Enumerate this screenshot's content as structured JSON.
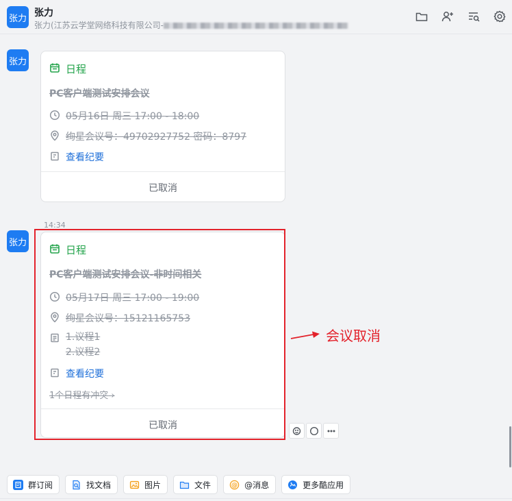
{
  "header": {
    "avatar_text": "张力",
    "name": "张力",
    "subtitle_prefix": "张力(江苏云学堂网络科技有限公司-"
  },
  "messages": [
    {
      "avatar_text": "张力",
      "card_title": "日程",
      "subject": "PC客户端测试安排会议",
      "time": "05月16日 周三 17:00 - 18:00",
      "meeting": "绚星会议号：49702927752 密码：8797",
      "notes_link": "查看纪要",
      "status": "已取消"
    },
    {
      "timestamp": "14:34",
      "avatar_text": "张力",
      "card_title": "日程",
      "subject": "PC客户端测试安排会议-非时间相关",
      "time": "05月17日 周三 17:00 - 19:00",
      "meeting": "绚星会议号：15121165753",
      "agenda": [
        "1.议程1",
        "2.议程2"
      ],
      "notes_link": "查看纪要",
      "conflict": "1个日程有冲突",
      "status": "已取消"
    }
  ],
  "annotation": {
    "text": "会议取消",
    "color": "#e3212a"
  },
  "toolbar": [
    {
      "label": "群订阅",
      "icon": "subscribe-icon"
    },
    {
      "label": "找文档",
      "icon": "find-doc-icon"
    },
    {
      "label": "图片",
      "icon": "image-icon"
    },
    {
      "label": "文件",
      "icon": "folder-icon"
    },
    {
      "label": "@消息",
      "icon": "at-icon"
    },
    {
      "label": "更多酷应用",
      "icon": "apps-icon"
    }
  ],
  "colors": {
    "accent": "#1e7cf2",
    "schedule_green": "#22a34a",
    "link_blue": "#1e6fd9"
  }
}
